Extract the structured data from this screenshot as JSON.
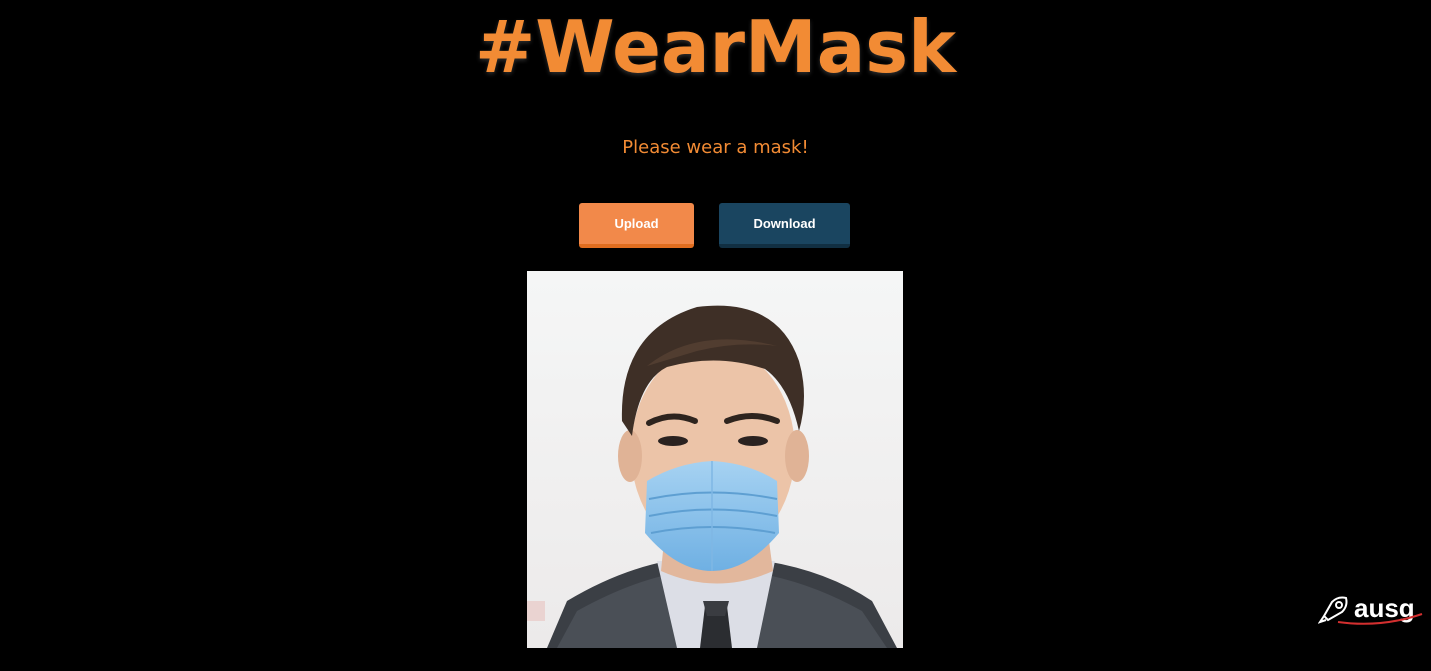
{
  "header": {
    "title": "#WearMask",
    "subtitle": "Please wear a mask!"
  },
  "actions": {
    "upload_label": "Upload",
    "download_label": "Download"
  },
  "preview": {
    "alt": "Photo of a man in a suit wearing a blue surgical mask"
  },
  "watermark": {
    "text": "ausg",
    "icon": "rocket-icon"
  },
  "colors": {
    "background": "#000000",
    "accent": "#f28b34",
    "upload_button": "#f2894a",
    "download_button": "#1a4560",
    "mask": "#8fc3ea"
  }
}
